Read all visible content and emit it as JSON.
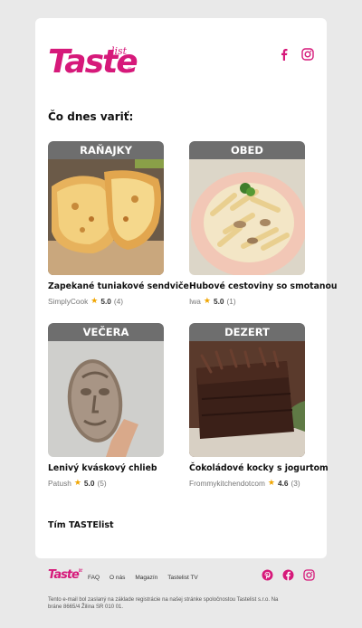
{
  "brand": {
    "name": "Taste",
    "sub": "list",
    "color": "#d6197a"
  },
  "header": {
    "icons": [
      "facebook-icon",
      "instagram-icon"
    ]
  },
  "heading": "Čo dnes variť:",
  "tiles": [
    {
      "banner": "RAŇAJKY",
      "title": "Zapekané tuniakové sendviče",
      "author": "SimplyCook",
      "rating": "5.0",
      "count": "(4)"
    },
    {
      "banner": "OBED",
      "title": "Hubové cestoviny so smotanou",
      "author": "Iwa",
      "rating": "5.0",
      "count": "(1)"
    },
    {
      "banner": "VEČERA",
      "title": "Lenivý kváskový chlieb",
      "author": "Patush",
      "rating": "5.0",
      "count": "(5)"
    },
    {
      "banner": "DEZERT",
      "title": "Čokoládové kocky s jogurtom",
      "author": "Frommykitchendotcom",
      "rating": "4.6",
      "count": "(3)"
    }
  ],
  "signoff": "Tím TASTElist",
  "footer": {
    "logo": "Taste",
    "logo_sub": "list",
    "nav": [
      "FAQ",
      "O nás",
      "Magazín",
      "Tastelist TV"
    ],
    "icons": [
      "pinterest-icon",
      "facebook-icon",
      "instagram-icon"
    ],
    "legal": "Tento e-mail bol zaslaný na základe registrácie na našej stránke spoločnostou Tastelist s.r.o. Na bráne 8665/4 Žilina SR 010 01."
  }
}
